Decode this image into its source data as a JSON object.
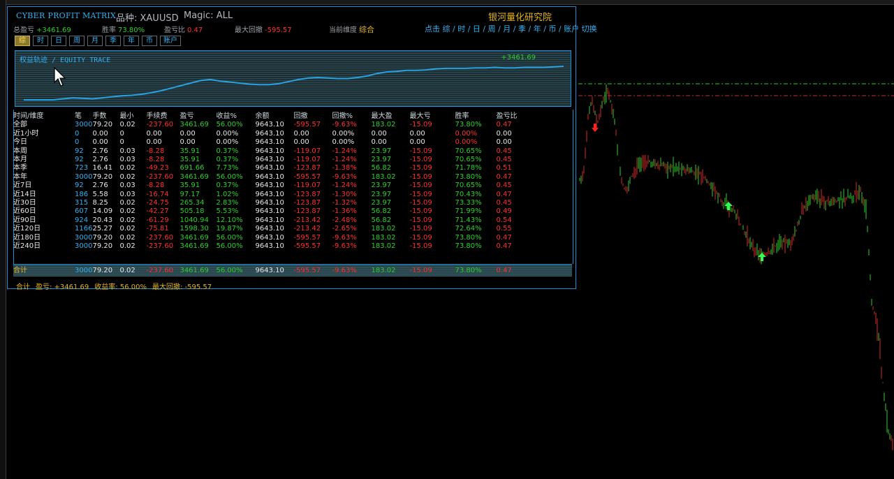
{
  "header": {
    "title": "CYBER PROFIT MATRIX",
    "symbol": "品种: XAUUSD",
    "magic": "Magic: ALL",
    "brand": "银河量化研究院"
  },
  "stats": {
    "total_pl_label": "总盈亏",
    "total_pl_value": "+3461.69",
    "winrate_label": "胜率",
    "winrate_value": "73.80%",
    "plratio_label": "盈亏比",
    "plratio_value": "0.47",
    "maxdd_label": "最大回撤",
    "maxdd_value": "-595.57",
    "dimension_label": "当前维度",
    "dimension_value": "综合"
  },
  "switch_hint": "点击 综 / 时 / 日 / 周 / 月 / 季 / 年 / 币 / 账户 切换",
  "tabs": [
    {
      "label": "综",
      "active": true
    },
    {
      "label": "时",
      "active": false
    },
    {
      "label": "日",
      "active": false
    },
    {
      "label": "周",
      "active": false
    },
    {
      "label": "月",
      "active": false
    },
    {
      "label": "季",
      "active": false
    },
    {
      "label": "年",
      "active": false
    },
    {
      "label": "币",
      "active": false
    },
    {
      "label": "账户",
      "active": false
    }
  ],
  "equity": {
    "title": "权益轨迹 / EQUITY TRACE",
    "value": "+3461.69",
    "line_color": "#29a3e0",
    "points": [
      0,
      0,
      0,
      0,
      2,
      4,
      3,
      2,
      4,
      6,
      8,
      9,
      11,
      14,
      18,
      23,
      28,
      33,
      38,
      40,
      37,
      35,
      33,
      31,
      30,
      30,
      32,
      36,
      40,
      43,
      44,
      43,
      42,
      42,
      44,
      47,
      52,
      55,
      56,
      58,
      58,
      59,
      61,
      62,
      62,
      62,
      63,
      63,
      64,
      63,
      63,
      64,
      64,
      64,
      65,
      66
    ]
  },
  "table": {
    "headers": [
      "时间/维度",
      "笔",
      "手数",
      "最小",
      "手续费",
      "盈亏",
      "收益%",
      "余额",
      "回撤",
      "回撤%",
      "最大盈",
      "最大亏",
      "胜率",
      "盈亏比"
    ],
    "rows": [
      [
        "全部",
        "3000",
        "79.20",
        "0.02",
        "-237.60",
        "3461.69",
        "56.00%",
        "9643.10",
        "-595.57",
        "-9.63%",
        "183.02",
        "-15.09",
        "73.80%",
        "0.47"
      ],
      [
        "近1小时",
        "0",
        "0.00",
        "0",
        "0.00",
        "0.00",
        "0.00%",
        "9643.10",
        "0.00",
        "0.00%",
        "0.00",
        "0.00",
        "0.00%",
        "0.00"
      ],
      [
        "今日",
        "0",
        "0.00",
        "0",
        "0.00",
        "0.00",
        "0.00%",
        "9643.10",
        "0.00",
        "0.00%",
        "0.00",
        "0.00",
        "0.00%",
        "0.00"
      ],
      [
        "本周",
        "92",
        "2.76",
        "0.03",
        "-8.28",
        "35.91",
        "0.37%",
        "9643.10",
        "-119.07",
        "-1.24%",
        "23.97",
        "-15.09",
        "70.65%",
        "0.45"
      ],
      [
        "本月",
        "92",
        "2.76",
        "0.03",
        "-8.28",
        "35.91",
        "0.37%",
        "9643.10",
        "-119.07",
        "-1.24%",
        "23.97",
        "-15.09",
        "70.65%",
        "0.45"
      ],
      [
        "本季",
        "723",
        "16.41",
        "0.02",
        "-49.23",
        "691.66",
        "7.73%",
        "9643.10",
        "-123.87",
        "-1.38%",
        "56.82",
        "-15.09",
        "71.78%",
        "0.51"
      ],
      [
        "本年",
        "3000",
        "79.20",
        "0.02",
        "-237.60",
        "3461.69",
        "56.00%",
        "9643.10",
        "-595.57",
        "-9.63%",
        "183.02",
        "-15.09",
        "73.80%",
        "0.47"
      ],
      [
        "近7日",
        "92",
        "2.76",
        "0.03",
        "-8.28",
        "35.91",
        "0.37%",
        "9643.10",
        "-119.07",
        "-1.24%",
        "23.97",
        "-15.09",
        "70.65%",
        "0.45"
      ],
      [
        "近14日",
        "186",
        "5.58",
        "0.03",
        "-16.74",
        "97.17",
        "1.02%",
        "9643.10",
        "-123.87",
        "-1.30%",
        "23.97",
        "-15.09",
        "70.43%",
        "0.47"
      ],
      [
        "近30日",
        "315",
        "8.25",
        "0.02",
        "-24.75",
        "265.34",
        "2.83%",
        "9643.10",
        "-123.87",
        "-1.32%",
        "23.97",
        "-15.09",
        "73.33%",
        "0.45"
      ],
      [
        "近60日",
        "607",
        "14.09",
        "0.02",
        "-42.27",
        "505.18",
        "5.53%",
        "9643.10",
        "-123.87",
        "-1.36%",
        "56.82",
        "-15.09",
        "71.99%",
        "0.49"
      ],
      [
        "近90日",
        "924",
        "20.43",
        "0.02",
        "-61.29",
        "1040.94",
        "12.10%",
        "9643.10",
        "-213.42",
        "-2.48%",
        "56.82",
        "-15.09",
        "71.43%",
        "0.54"
      ],
      [
        "近120日",
        "1166",
        "25.27",
        "0.02",
        "-75.81",
        "1598.30",
        "19.87%",
        "9643.10",
        "-213.42",
        "-2.65%",
        "183.02",
        "-15.09",
        "72.64%",
        "0.55"
      ],
      [
        "近180日",
        "3000",
        "79.20",
        "0.02",
        "-237.60",
        "3461.69",
        "56.00%",
        "9643.10",
        "-595.57",
        "-9.63%",
        "183.02",
        "-15.09",
        "73.80%",
        "0.47"
      ],
      [
        "近240日",
        "3000",
        "79.20",
        "0.02",
        "-237.60",
        "3461.69",
        "56.00%",
        "9643.10",
        "-595.57",
        "-9.63%",
        "183.02",
        "-15.09",
        "73.80%",
        "0.47"
      ]
    ],
    "total": [
      "合计",
      "3000",
      "79.20",
      "0.02",
      "-237.60",
      "3461.69",
      "56.00%",
      "9643.10",
      "-595.57",
      "-9.63%",
      "183.02",
      "-15.09",
      "73.80%",
      "0.47"
    ]
  },
  "footer": {
    "label": "合计",
    "pl": "盈亏: +3461.69",
    "ret": "收益率: 56.00%",
    "dd": "最大回撤: -595.57"
  },
  "colors": {
    "accent": "#1e8fd6",
    "profit": "#2bd12b",
    "loss": "#ff3030",
    "gold": "#e6b422"
  }
}
